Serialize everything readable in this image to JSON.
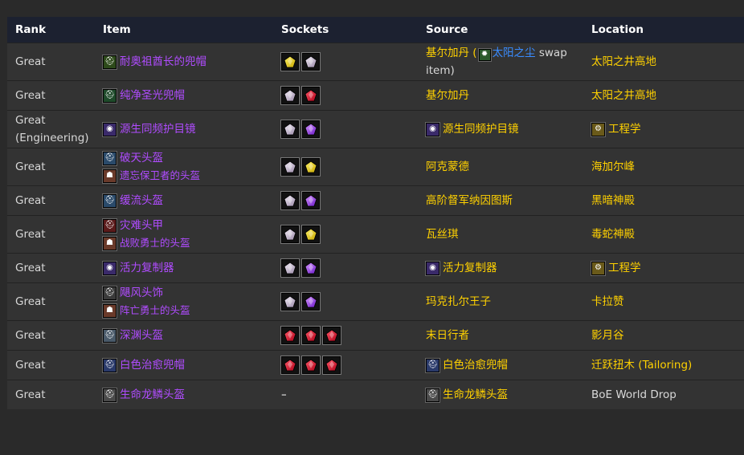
{
  "headers": [
    "Rank",
    "Item",
    "Sockets",
    "Source",
    "Location"
  ],
  "rows": [
    {
      "rank": "Great",
      "items": [
        {
          "name": "耐奥祖酋长的兜帽",
          "icon": "hood-green-icon"
        }
      ],
      "sockets": [
        "yellow",
        "prismatic"
      ],
      "source": {
        "parts": [
          "基尔加丹 (",
          "太阳之尘",
          " swap item)"
        ]
      },
      "location": "太阳之井高地"
    },
    {
      "rank": "Great",
      "items": [
        {
          "name": "纯净圣光兜帽",
          "icon": "hood-green-icon"
        }
      ],
      "sockets": [
        "prismatic",
        "red"
      ],
      "source": {
        "text": "基尔加丹"
      },
      "location": "太阳之井高地"
    },
    {
      "rank": "Great (Engineering)",
      "items": [
        {
          "name": "源生同频护目镜",
          "icon": "goggles-icon"
        }
      ],
      "sockets": [
        "prismatic",
        "purple"
      ],
      "source": {
        "text": "源生同频护目镜",
        "icon": "goggles-icon"
      },
      "location": "工程学",
      "location_icon": "engineering-icon"
    },
    {
      "rank": "Great",
      "items": [
        {
          "name": "破天头盔",
          "icon": "helm-blue-icon"
        },
        {
          "name": "遗忘保卫者的头盔",
          "icon": "token-icon"
        }
      ],
      "sockets": [
        "prismatic",
        "yellow"
      ],
      "source": {
        "text": "阿克蒙德"
      },
      "location": "海加尔峰"
    },
    {
      "rank": "Great",
      "items": [
        {
          "name": "缓流头盔",
          "icon": "helm-blue-icon"
        }
      ],
      "sockets": [
        "prismatic",
        "purple"
      ],
      "source": {
        "text": "高阶督军纳因图斯"
      },
      "location": "黑暗神殿"
    },
    {
      "rank": "Great",
      "items": [
        {
          "name": "灾难头甲",
          "icon": "helm-red-icon"
        },
        {
          "name": "战败勇士的头盔",
          "icon": "token-icon"
        }
      ],
      "sockets": [
        "prismatic",
        "yellow"
      ],
      "source": {
        "text": "瓦丝琪"
      },
      "location": "毒蛇神殿"
    },
    {
      "rank": "Great",
      "items": [
        {
          "name": "活力复制器",
          "icon": "goggles-icon"
        }
      ],
      "sockets": [
        "prismatic",
        "purple"
      ],
      "source": {
        "text": "活力复制器",
        "icon": "goggles-icon"
      },
      "location": "工程学",
      "location_icon": "engineering-icon"
    },
    {
      "rank": "Great",
      "items": [
        {
          "name": "飓风头饰",
          "icon": "helm-dark-icon"
        },
        {
          "name": "阵亡勇士的头盔",
          "icon": "token-icon"
        }
      ],
      "sockets": [
        "prismatic",
        "purple"
      ],
      "source": {
        "text": "玛克扎尔王子"
      },
      "location": "卡拉赞"
    },
    {
      "rank": "Great",
      "items": [
        {
          "name": "深渊头盔",
          "icon": "helm-silver-icon"
        }
      ],
      "sockets": [
        "red",
        "red",
        "red"
      ],
      "source": {
        "text": "末日行者"
      },
      "location": "影月谷"
    },
    {
      "rank": "Great",
      "items": [
        {
          "name": "白色治愈兜帽",
          "icon": "hood-white-icon"
        }
      ],
      "sockets": [
        "red",
        "red",
        "red"
      ],
      "source": {
        "text": "白色治愈兜帽",
        "icon": "hood-white-icon"
      },
      "location": "迁跃扭木 (Tailoring)"
    },
    {
      "rank": "Great",
      "items": [
        {
          "name": "生命龙鳞头盔",
          "icon": "helm-scale-icon"
        }
      ],
      "sockets": [],
      "sockets_empty": "–",
      "source": {
        "text": "生命龙鳞头盔",
        "icon": "helm-scale-icon"
      },
      "location": "BoE World Drop",
      "location_grey": true
    }
  ],
  "colors": {
    "header_bg": "#1c2130",
    "row_bg": "#333333",
    "epic": "#b04cff",
    "source": "#ffd100",
    "link": "#3a8cff"
  }
}
